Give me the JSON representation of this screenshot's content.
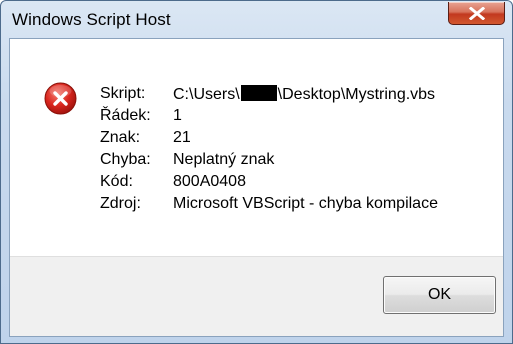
{
  "window": {
    "title": "Windows Script Host"
  },
  "message": {
    "rows": [
      {
        "key": "Skript:",
        "value_prefix": "C:\\Users\\",
        "value_suffix": "\\Desktop\\Mystring.vbs"
      },
      {
        "key": "Řádek:",
        "value": "1"
      },
      {
        "key": "Znak:",
        "value": "21"
      },
      {
        "key": "Chyba:",
        "value": "Neplatný znak"
      },
      {
        "key": "Kód:",
        "value": "800A0408"
      },
      {
        "key": "Zdroj:",
        "value": "Microsoft VBScript - chyba kompilace"
      }
    ]
  },
  "buttons": {
    "ok_label": "OK"
  },
  "icons": {
    "title_close": "close-icon",
    "status": "error-icon"
  },
  "colors": {
    "error_red": "#d9251d",
    "close_button_red": "#c2391f"
  }
}
